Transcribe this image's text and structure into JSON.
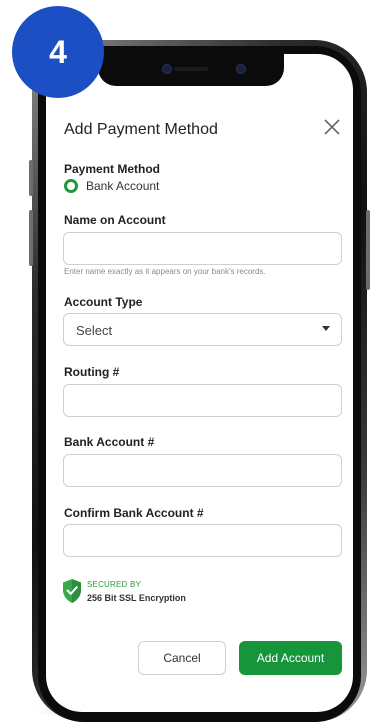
{
  "step": {
    "number": "4"
  },
  "modal": {
    "title": "Add Payment Method",
    "payment_method": {
      "label": "Payment Method",
      "selected": "Bank Account"
    },
    "name_on_account": {
      "label": "Name on Account",
      "value": "",
      "hint": "Enter name exactly as it appears on your bank's records."
    },
    "account_type": {
      "label": "Account Type",
      "selected": "Select"
    },
    "routing": {
      "label": "Routing #",
      "value": ""
    },
    "bank_account": {
      "label": "Bank Account #",
      "value": ""
    },
    "confirm_bank_account": {
      "label": "Confirm Bank Account #",
      "value": ""
    },
    "security": {
      "line1": "SECURED BY",
      "line2": "256 Bit SSL Encryption"
    },
    "buttons": {
      "cancel": "Cancel",
      "add": "Add Account"
    }
  },
  "colors": {
    "brand_green": "#17953b",
    "badge_blue": "#1c4fc4"
  },
  "icons": {
    "close": "close-icon",
    "radio": "radio-selected-icon",
    "caret": "chevron-down-icon",
    "shield": "shield-check-icon"
  }
}
